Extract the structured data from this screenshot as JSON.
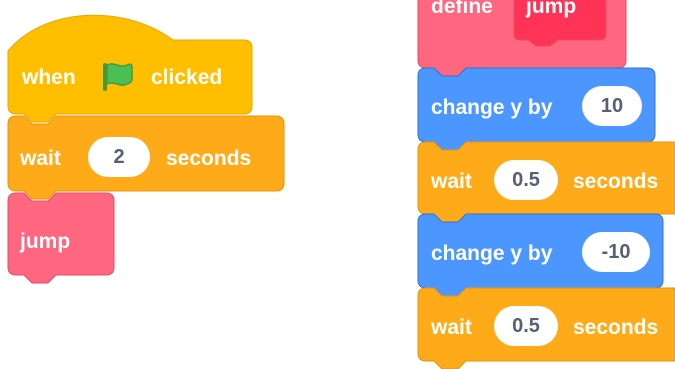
{
  "colors": {
    "events": "#FFBF00",
    "events_edge": "#E6A800",
    "control": "#FFAB19",
    "control_edge": "#E6940B",
    "custom": "#FF6680",
    "custom_edge": "#E64D65",
    "custom_inner": "#FF3355",
    "motion": "#4C97FF",
    "motion_edge": "#3373CC",
    "flag": "#4CBF56"
  },
  "main_script": {
    "hat": {
      "when_label": "when",
      "flag_icon": "green-flag-icon",
      "clicked_label": "clicked"
    },
    "wait": {
      "label": "wait",
      "value": "2",
      "unit": "seconds"
    },
    "call": {
      "label": "jump"
    }
  },
  "define_script": {
    "define": {
      "label": "define",
      "name": "jump"
    },
    "steps": [
      {
        "label": "change y by",
        "value": "10"
      },
      {
        "label": "wait",
        "value": "0.5",
        "unit": "seconds"
      },
      {
        "label": "change y by",
        "value": "-10"
      },
      {
        "label": "wait",
        "value": "0.5",
        "unit": "seconds"
      }
    ]
  }
}
